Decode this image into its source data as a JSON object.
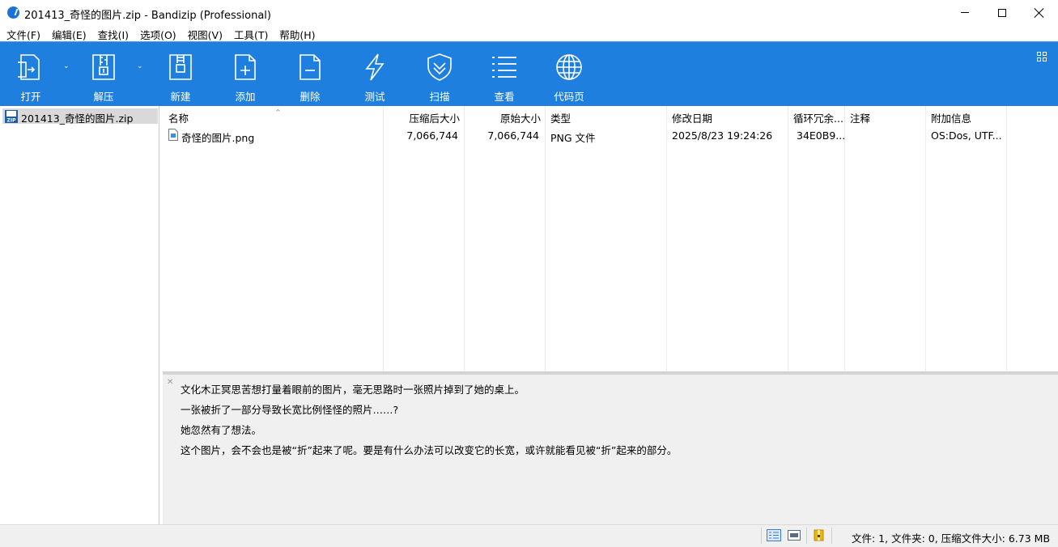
{
  "window": {
    "title": "201413_奇怪的图片.zip - Bandizip (Professional)",
    "minimize_icon": "minimize-icon",
    "maximize_icon": "maximize-icon",
    "close_icon": "close-icon"
  },
  "menu": [
    "文件(F)",
    "编辑(E)",
    "查找(I)",
    "选项(O)",
    "视图(V)",
    "工具(T)",
    "帮助(H)"
  ],
  "toolbar": {
    "open": "打开",
    "extract": "解压",
    "new": "新建",
    "add": "添加",
    "delete": "删除",
    "test": "测试",
    "scan": "扫描",
    "view": "查看",
    "codepage": "代码页"
  },
  "tree": {
    "archive_name": "201413_奇怪的图片.zip"
  },
  "columns": {
    "name": "名称",
    "packed": "压缩后大小",
    "size": "原始大小",
    "type": "类型",
    "modified": "修改日期",
    "crc": "循环冗余...",
    "comment": "注释",
    "extra": "附加信息"
  },
  "files": [
    {
      "name": "奇怪的图片.png",
      "packed": "7,066,744",
      "size": "7,066,744",
      "type": "PNG 文件",
      "modified": "2025/8/23 19:24:26",
      "crc": "34E0B9...",
      "comment": "",
      "extra": "OS:Dos, UTF..."
    }
  ],
  "comment_lines": [
    "文化木正冥思苦想打量着眼前的图片，毫无思路时一张照片掉到了她的桌上。",
    "一张被折了一部分导致长宽比例怪怪的照片……?",
    "她忽然有了想法。",
    "这个图片，会不会也是被“折”起来了呢。要是有什么办法可以改变它的长宽，或许就能看见被“折”起来的部分。"
  ],
  "status": {
    "summary": "文件: 1, 文件夹: 0, 压缩文件大小: 6.73 MB"
  },
  "colors": {
    "toolbar_bg": "#1e7fde",
    "selection_bg": "#d9d9d9",
    "comment_bg": "#f0f0f0"
  }
}
